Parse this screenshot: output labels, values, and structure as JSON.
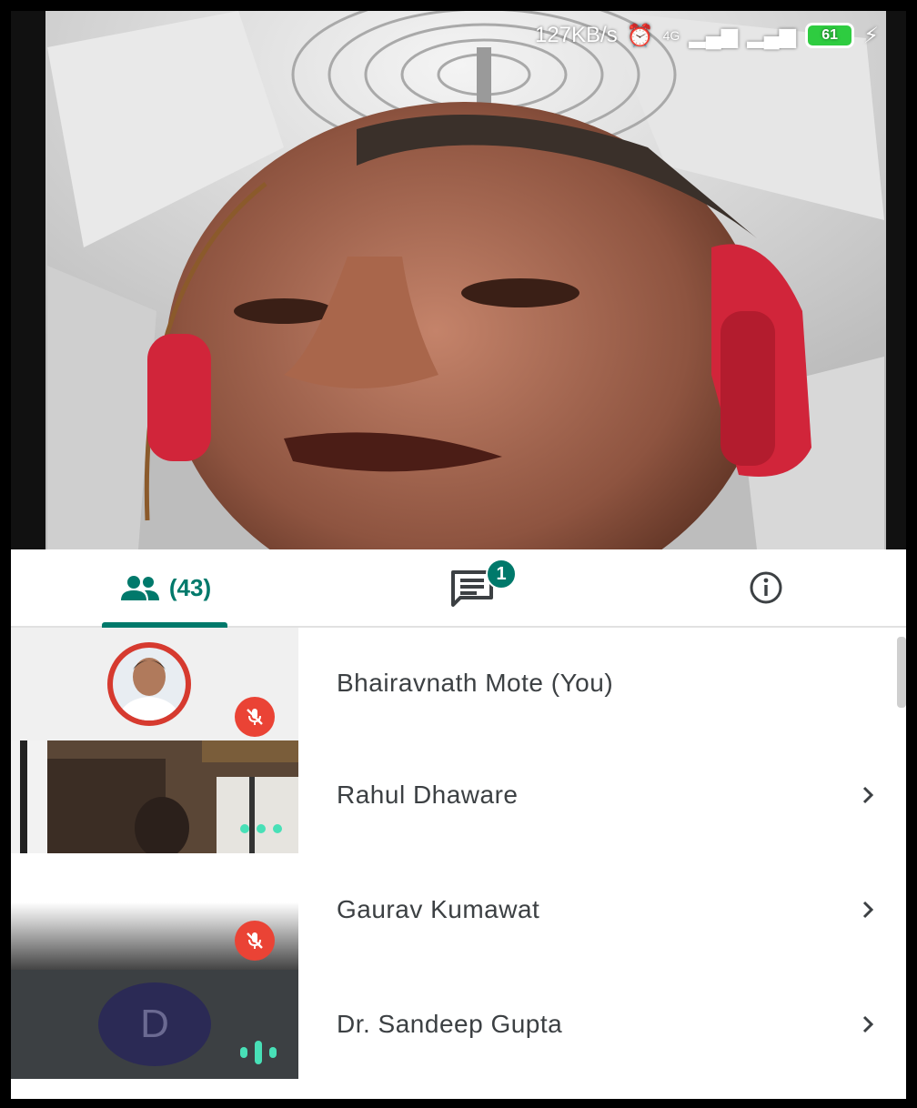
{
  "status_bar": {
    "speed": "127KB/s",
    "network": "4G",
    "battery": "61"
  },
  "tabs": {
    "people_count": "(43)",
    "chat_badge": "1",
    "people_icon": "people-icon",
    "chat_icon": "chat-icon",
    "info_icon": "info-icon"
  },
  "participants": [
    {
      "name": "Bhairavnath Mote (You)",
      "muted": true,
      "has_chevron": false
    },
    {
      "name": "Rahul Dhaware",
      "muted": false,
      "speaking_indicator": "dots",
      "has_chevron": true
    },
    {
      "name": "Gaurav Kumawat",
      "muted": true,
      "has_chevron": true
    },
    {
      "name": "Dr. Sandeep Gupta",
      "avatar_letter": "D",
      "speaking_indicator": "bars",
      "has_chevron": true
    }
  ],
  "colors": {
    "accent": "#00796b",
    "mic_off": "#ea4335",
    "speaking": "#48e0b7",
    "avatar_d": "#2b2a55"
  }
}
